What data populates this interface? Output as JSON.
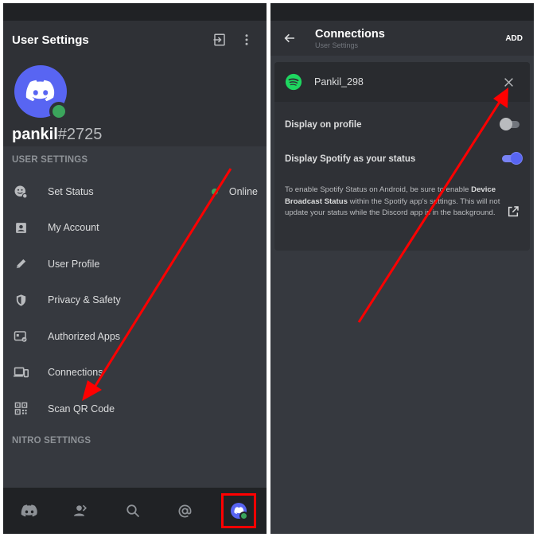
{
  "left": {
    "header": {
      "title": "User Settings"
    },
    "profile": {
      "name": "pankil",
      "discriminator": "#2725"
    },
    "section_user": "USER SETTINGS",
    "status": {
      "label": "Set Status",
      "value": "Online"
    },
    "items": [
      {
        "label": "My Account",
        "icon": "account-icon"
      },
      {
        "label": "User Profile",
        "icon": "pencil-icon"
      },
      {
        "label": "Privacy & Safety",
        "icon": "shield-icon"
      },
      {
        "label": "Authorized Apps",
        "icon": "authorized-apps-icon"
      },
      {
        "label": "Connections",
        "icon": "devices-icon"
      },
      {
        "label": "Scan QR Code",
        "icon": "qr-code-icon"
      }
    ],
    "section_nitro": "NITRO SETTINGS"
  },
  "right": {
    "header": {
      "title": "Connections",
      "subtitle": "User Settings",
      "add_label": "ADD"
    },
    "connection": {
      "account": "Pankil_298",
      "service_icon": "spotify-icon"
    },
    "options": [
      {
        "label": "Display on profile",
        "enabled": false
      },
      {
        "label": "Display Spotify as your status",
        "enabled": true
      }
    ],
    "info": {
      "part1": "To enable Spotify Status on Android, be sure to enable ",
      "bold": "Device Broadcast Status",
      "part2": " within the Spotify app's settings. This will not update your status while the Discord app is in the background."
    }
  },
  "colors": {
    "background": "#36393f",
    "header": "#2f3136",
    "nav": "#202225",
    "blurple": "#5865f2",
    "online": "#3ba55c",
    "spotify": "#1ed760",
    "annotation": "#ff0000"
  }
}
